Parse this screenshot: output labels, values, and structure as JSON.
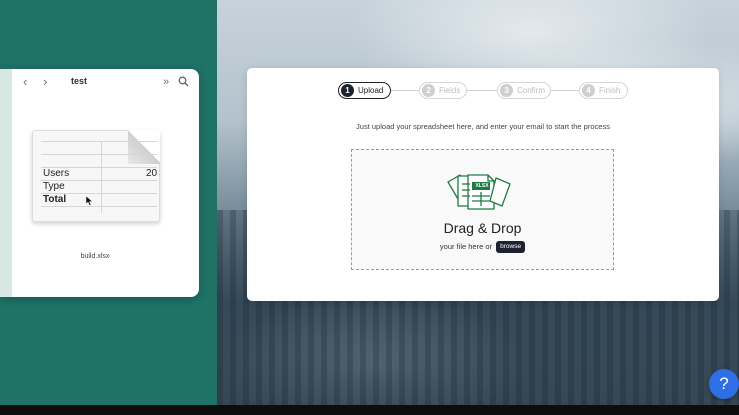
{
  "finder": {
    "title": "test",
    "back_icon": "chevron-left-icon",
    "forward_icon": "chevron-right-icon",
    "more_icon": "double-chevron-right-icon",
    "search_icon": "search-icon",
    "file": {
      "name": "build.xlsx",
      "preview_rows": [
        {
          "label": "Users",
          "value": "20"
        },
        {
          "label": "Type",
          "value": ""
        },
        {
          "label": "Total",
          "value": ""
        }
      ]
    }
  },
  "uploader": {
    "steps": [
      {
        "num": "1",
        "label": "Upload",
        "active": true
      },
      {
        "num": "2",
        "label": "Fields",
        "active": false
      },
      {
        "num": "3",
        "label": "Confirm",
        "active": false
      },
      {
        "num": "4",
        "label": "Finish",
        "active": false
      }
    ],
    "instructions": "Just upload your spreadsheet here, and enter your email to start the process",
    "dropzone": {
      "icon": "xlsx-files-icon",
      "icon_badge": "XLSX",
      "title": "Drag & Drop",
      "subtitle": "your file here or",
      "browse_label": "browse"
    }
  },
  "help": {
    "label": "?"
  },
  "colors": {
    "teal": "#1f7366",
    "dark": "#1c2230",
    "help_blue": "#2f6fe6",
    "xlsx_green": "#1f7a43"
  }
}
